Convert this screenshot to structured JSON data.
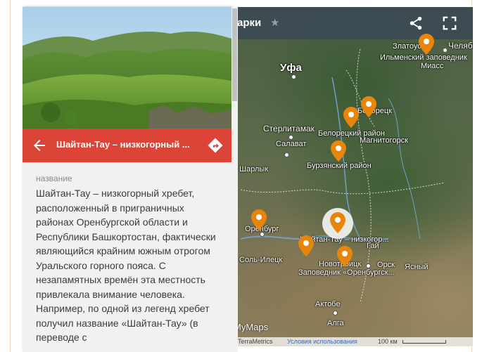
{
  "map": {
    "title": "арки",
    "icons": {
      "star": "star-icon",
      "share": "share-icon",
      "fullscreen": "fullscreen-icon"
    },
    "labels": {
      "ufa": "Уфа",
      "chelyabinsk": "Челябі",
      "zlatoust": "Златоуст",
      "ilmensky": "Ильменский заповедник",
      "miass": "Миасс",
      "beloretsk": "Белорецк",
      "sterlitamak": "Стерлитамак",
      "beloretsky_rayon": "Белорецкий район",
      "salavat": "Салават",
      "magnitogorsk": "Магнитогорск",
      "burzyansky": "Бурзянский район",
      "sharlyk": "Шарлык",
      "orenburg": "Оренбург",
      "shaitan_tau": "Шайтан-Тау – низкогор...",
      "gai": "Гай",
      "sol_iletsk": "Соль-Илецк",
      "novotroitsk": "Новотроицк",
      "orsk": "Орск",
      "zapovednik": "Заповедник «Оренбургск...",
      "yasny": "Ясный",
      "aktobe": "Актобе",
      "alga": "Алга"
    },
    "attribution": {
      "logo": "MyMaps",
      "terrametrics": "TerraMetrics",
      "terms": "Условия использования",
      "scale": "100 км"
    },
    "pin_color": "#e8860c"
  },
  "panel": {
    "title": "Шайтан-Тау – низкогорный ...",
    "field_label": "название",
    "description": "Шайтан-Тау – низкогорный хребет, расположенный в приграничных районах Оренбургской области и Республики Башкортостан, фактически являющийся крайним южным отрогом Уральского горного пояса. С незапамятных времён эта местность привлекала внимание человека. Например, по одной из легенд хребет получил название «Шайтан-Тау» (в переводе с",
    "accent_color": "#db4437",
    "icons": {
      "back": "arrow-left-icon",
      "directions": "directions-icon"
    }
  }
}
